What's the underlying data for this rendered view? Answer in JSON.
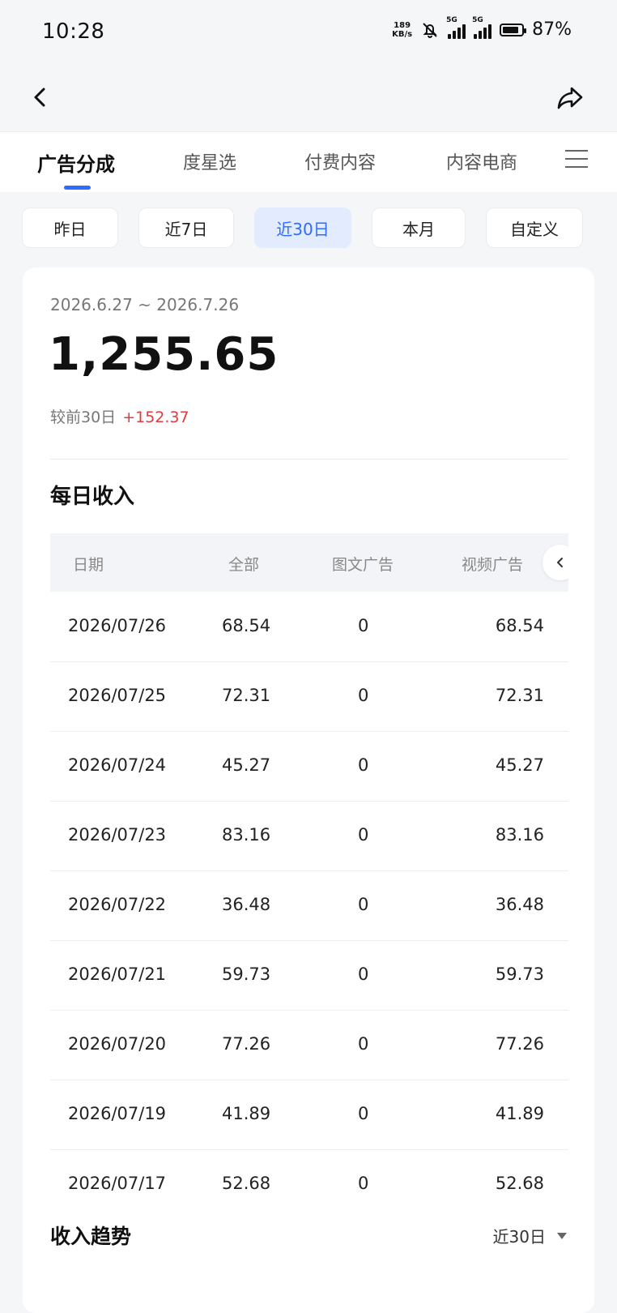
{
  "status": {
    "time": "10:28",
    "speed_value": "189",
    "speed_unit": "KB/s",
    "net1": "5G",
    "net2": "5G",
    "battery": "87%"
  },
  "tabs": [
    "广告分成",
    "度星选",
    "付费内容",
    "内容电商"
  ],
  "ranges": [
    "昨日",
    "近7日",
    "近30日",
    "本月",
    "自定义"
  ],
  "summary": {
    "date_range": "2026.6.27 ~ 2026.7.26",
    "total": "1,255.65",
    "compare_label": "较前30日",
    "compare_delta": "+152.37"
  },
  "daily": {
    "title": "每日收入",
    "headers": [
      "日期",
      "全部",
      "图文广告",
      "视频广告"
    ],
    "rows": [
      [
        "2026/07/26",
        "68.54",
        "0",
        "68.54"
      ],
      [
        "2026/07/25",
        "72.31",
        "0",
        "72.31"
      ],
      [
        "2026/07/24",
        "45.27",
        "0",
        "45.27"
      ],
      [
        "2026/07/23",
        "83.16",
        "0",
        "83.16"
      ],
      [
        "2026/07/22",
        "36.48",
        "0",
        "36.48"
      ],
      [
        "2026/07/21",
        "59.73",
        "0",
        "59.73"
      ],
      [
        "2026/07/20",
        "77.26",
        "0",
        "77.26"
      ],
      [
        "2026/07/19",
        "41.89",
        "0",
        "41.89"
      ],
      [
        "2026/07/17",
        "52.68",
        "0",
        "52.68"
      ]
    ]
  },
  "trend": {
    "title": "收入趋势",
    "range": "近30日"
  },
  "colors": {
    "accent": "#2f6bff",
    "positive": "#e23b3b",
    "active_chip_bg": "#e3ebff"
  }
}
